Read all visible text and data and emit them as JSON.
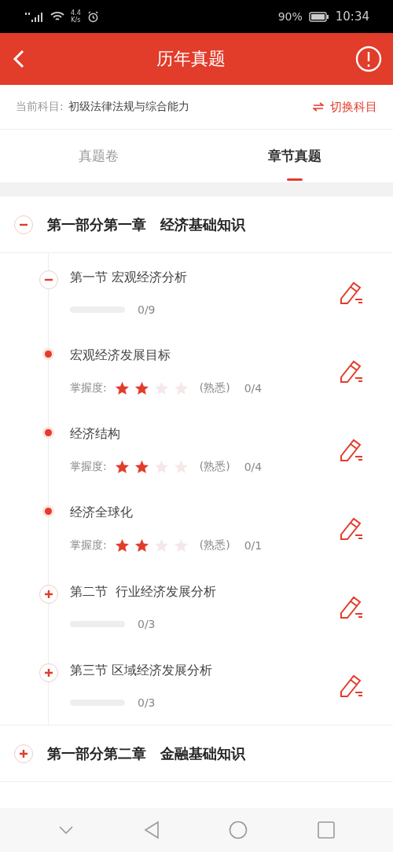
{
  "status_bar": {
    "speed_value": "4.4",
    "speed_unit": "K/s",
    "battery": "90%",
    "time": "10:34"
  },
  "header": {
    "title": "历年真题"
  },
  "subject": {
    "label": "当前科目:",
    "value": "初级法律法规与综合能力",
    "action": "切换科目"
  },
  "tabs": [
    {
      "label": "真题卷",
      "selected": false
    },
    {
      "label": "章节真题",
      "selected": true
    }
  ],
  "chapters": [
    {
      "part": "第一部分第一章",
      "name": "经济基础知识",
      "expanded": true,
      "children": [
        {
          "kind": "section",
          "title": "第一节 宏观经济分析",
          "expanded": true,
          "count": "0/9",
          "children": [
            {
              "kind": "point",
              "title": "宏观经济发展目标",
              "mastery_label": "掌握度:",
              "stars": 2,
              "mastery_text": "(熟悉)",
              "count": "0/4"
            },
            {
              "kind": "point",
              "title": "经济结构",
              "mastery_label": "掌握度:",
              "stars": 2,
              "mastery_text": "(熟悉)",
              "count": "0/4"
            },
            {
              "kind": "point",
              "title": "经济全球化",
              "mastery_label": "掌握度:",
              "stars": 2,
              "mastery_text": "(熟悉)",
              "count": "0/1"
            }
          ]
        },
        {
          "kind": "section",
          "title": "第二节  行业经济发展分析",
          "expanded": false,
          "count": "0/3"
        },
        {
          "kind": "section",
          "title": "第三节 区域经济发展分析",
          "expanded": false,
          "count": "0/3"
        }
      ]
    },
    {
      "part": "第一部分第二章",
      "name": "金融基础知识",
      "expanded": false
    }
  ]
}
